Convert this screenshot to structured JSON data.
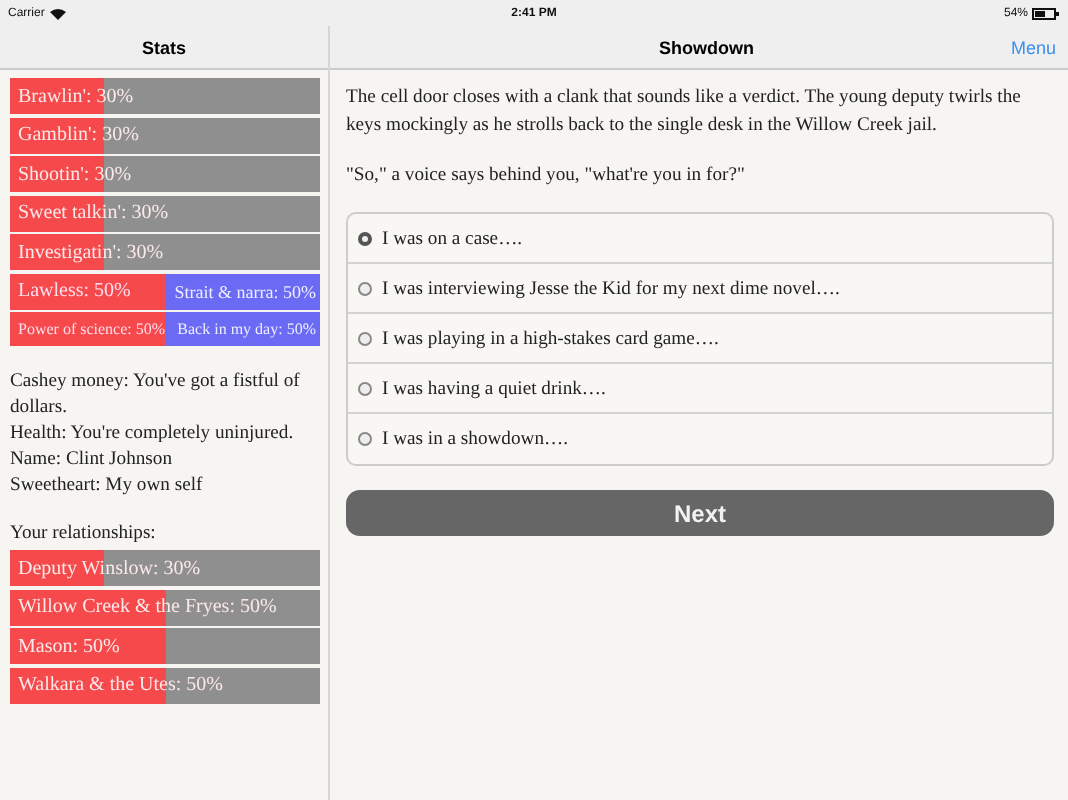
{
  "status_bar": {
    "carrier": "Carrier",
    "time": "2:41 PM",
    "battery": "54%"
  },
  "sidebar": {
    "title": "Stats",
    "stats": [
      {
        "kind": "bar",
        "label": "Brawlin': 30%",
        "level": 0.3
      },
      {
        "kind": "bar",
        "label": "Gamblin': 30%",
        "level": 0.3
      },
      {
        "kind": "bar",
        "label": "Shootin': 30%",
        "level": 0.3
      },
      {
        "kind": "bar",
        "label": "Sweet talkin': 30%",
        "level": 0.3
      },
      {
        "kind": "bar",
        "label": "Investigatin': 30%",
        "level": 0.3
      },
      {
        "kind": "opposed",
        "left": "Lawless: 50%",
        "right": "Strait & narra: 50%",
        "level": 0.5
      },
      {
        "kind": "opposed",
        "left": "Power of science: 50%",
        "right": "Back in my day: 50%",
        "level": 0.5,
        "small": true
      }
    ],
    "info": [
      "Cashey money: You've got a fistful of dollars.",
      "Health: You're completely uninjured.",
      "Name: Clint Johnson",
      "Sweetheart: My own self"
    ],
    "relationships_heading": "Your relationships:",
    "relationships": [
      {
        "label": "Deputy Winslow: 30%",
        "level": 0.3
      },
      {
        "label": "Willow Creek & the Fryes: 50%",
        "level": 0.5
      },
      {
        "label": "Mason: 50%",
        "level": 0.5
      },
      {
        "label": "Walkara & the Utes: 50%",
        "level": 0.5
      }
    ]
  },
  "main": {
    "title": "Showdown",
    "menu": "Menu",
    "paragraphs": [
      "The cell door closes with a clank that sounds like a verdict. The young deputy twirls the keys mockingly as he strolls back to the single desk in the Willow Creek jail.",
      "\"So,\" a voice says behind you, \"what're you in for?\""
    ],
    "choices": [
      {
        "label": "I was on a case….",
        "selected": true
      },
      {
        "label": "I was interviewing Jesse the Kid for my next dime novel….",
        "selected": false
      },
      {
        "label": "I was playing in a high-stakes card game….",
        "selected": false
      },
      {
        "label": "I was having a quiet drink….",
        "selected": false
      },
      {
        "label": "I was in a showdown….",
        "selected": false
      }
    ],
    "next_button": "Next"
  }
}
